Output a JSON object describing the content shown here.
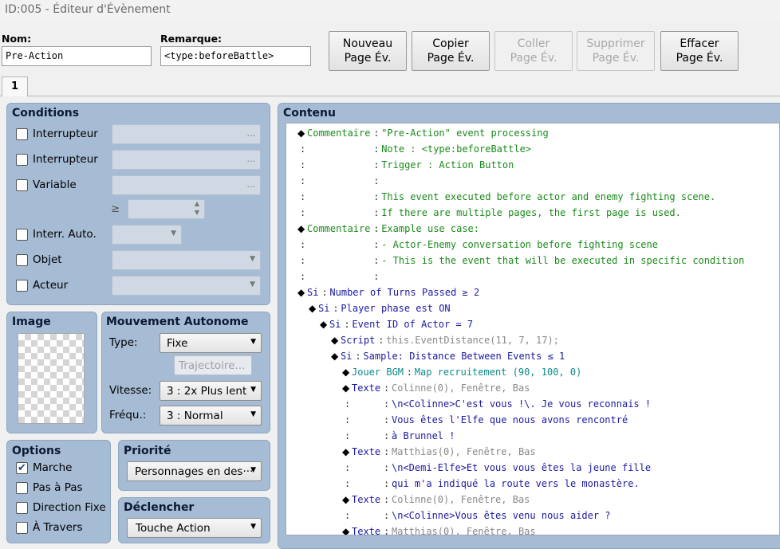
{
  "window": {
    "title": "ID:005 - Éditeur d'Évènement"
  },
  "header": {
    "name_label": "Nom:",
    "name_value": "Pre-Action",
    "note_label": "Remarque:",
    "note_value": "<type:beforeBattle>"
  },
  "buttons": [
    {
      "line1": "Nouveau",
      "line2": "Page Év.",
      "enabled": true
    },
    {
      "line1": "Copier",
      "line2": "Page Év.",
      "enabled": true
    },
    {
      "line1": "Coller",
      "line2": "Page Év.",
      "enabled": false
    },
    {
      "line1": "Supprimer",
      "line2": "Page Év.",
      "enabled": false
    },
    {
      "line1": "Effacer",
      "line2": "Page Év.",
      "enabled": true
    }
  ],
  "tabs": [
    "1"
  ],
  "conditions": {
    "title": "Conditions",
    "switch1": "Interrupteur",
    "switch2": "Interrupteur",
    "variable": "Variable",
    "gte": "≥",
    "self_switch": "Interr. Auto.",
    "item": "Objet",
    "actor": "Acteur",
    "dots": "..."
  },
  "image": {
    "title": "Image"
  },
  "movement": {
    "title": "Mouvement Autonome",
    "type_label": "Type:",
    "type_value": "Fixe",
    "route_button": "Trajectoire...",
    "speed_label": "Vitesse:",
    "speed_value": "3 : 2x Plus lent",
    "freq_label": "Fréqu.:",
    "freq_value": "3 : Normal"
  },
  "options": {
    "title": "Options",
    "walking": "Marche",
    "stepping": "Pas à Pas",
    "direction_fix": "Direction Fixe",
    "through": "À Travers"
  },
  "priority": {
    "title": "Priorité",
    "value": "Personnages en des···"
  },
  "trigger": {
    "title": "Déclencher",
    "value": "Touche Action"
  },
  "contents": {
    "title": "Contenu",
    "lines": [
      {
        "indent": 0,
        "diamond": true,
        "cmd": "Commentaire",
        "color": "g",
        "text": "\"Pre-Action\" event processing",
        "tcolor": "g"
      },
      {
        "indent": 0,
        "diamond": false,
        "cmd": "",
        "color": "k",
        "text": "Note : <type:beforeBattle>",
        "tcolor": "g"
      },
      {
        "indent": 0,
        "diamond": false,
        "cmd": "",
        "color": "k",
        "text": "Trigger : Action Button",
        "tcolor": "g"
      },
      {
        "indent": 0,
        "diamond": false,
        "cmd": "",
        "color": "k",
        "text": "",
        "tcolor": "g"
      },
      {
        "indent": 0,
        "diamond": false,
        "cmd": "",
        "color": "k",
        "text": "This event executed before actor and enemy fighting scene.",
        "tcolor": "g"
      },
      {
        "indent": 0,
        "diamond": false,
        "cmd": "",
        "color": "k",
        "text": "If there are multiple pages, the first page is used.",
        "tcolor": "g"
      },
      {
        "indent": 0,
        "diamond": true,
        "cmd": "Commentaire",
        "color": "g",
        "text": "Example use case:",
        "tcolor": "g"
      },
      {
        "indent": 0,
        "diamond": false,
        "cmd": "",
        "color": "k",
        "text": "- Actor-Enemy conversation before fighting scene",
        "tcolor": "g"
      },
      {
        "indent": 0,
        "diamond": false,
        "cmd": "",
        "color": "k",
        "text": "- This is the event that will be executed in specific condition",
        "tcolor": "g"
      },
      {
        "indent": 0,
        "diamond": false,
        "cmd": "",
        "color": "k",
        "text": "",
        "tcolor": "g"
      },
      {
        "indent": 0,
        "diamond": true,
        "cmd": "Si",
        "color": "b",
        "text": "Number of Turns Passed ≥ 2",
        "tcolor": "b"
      },
      {
        "indent": 1,
        "diamond": true,
        "cmd": "Si",
        "color": "b",
        "text": "Player phase est ON",
        "tcolor": "b"
      },
      {
        "indent": 2,
        "diamond": true,
        "cmd": "Si",
        "color": "b",
        "text": "Event ID of Actor = 7",
        "tcolor": "b"
      },
      {
        "indent": 3,
        "diamond": true,
        "cmd": "Script",
        "color": "b",
        "text": "this.EventDistance(11, 7, 17);",
        "tcolor": "gr"
      },
      {
        "indent": 3,
        "diamond": true,
        "cmd": "Si",
        "color": "b",
        "text": "Sample: Distance Between Events ≤ 1",
        "tcolor": "b"
      },
      {
        "indent": 4,
        "diamond": true,
        "cmd": "Jouer BGM",
        "color": "t",
        "text": "Map recruitement (90, 100, 0)",
        "tcolor": "t"
      },
      {
        "indent": 4,
        "diamond": true,
        "cmd": "Texte",
        "color": "b",
        "text": "Colinne(0), Fenêtre, Bas",
        "tcolor": "gr"
      },
      {
        "indent": 4,
        "diamond": false,
        "cmd": "",
        "color": "k",
        "text": "\\n<Colinne>C'est vous !\\. Je vous reconnais !",
        "tcolor": "b"
      },
      {
        "indent": 4,
        "diamond": false,
        "cmd": "",
        "color": "k",
        "text": "Vous êtes l'Elfe que nous avons rencontré",
        "tcolor": "b"
      },
      {
        "indent": 4,
        "diamond": false,
        "cmd": "",
        "color": "k",
        "text": "à Brunnel !",
        "tcolor": "b"
      },
      {
        "indent": 4,
        "diamond": true,
        "cmd": "Texte",
        "color": "b",
        "text": "Matthias(0), Fenêtre, Bas",
        "tcolor": "gr"
      },
      {
        "indent": 4,
        "diamond": false,
        "cmd": "",
        "color": "k",
        "text": "\\n<Demi-Elfe>Et vous vous êtes la jeune fille",
        "tcolor": "b"
      },
      {
        "indent": 4,
        "diamond": false,
        "cmd": "",
        "color": "k",
        "text": "qui m'a indiqué la route vers le monastère.",
        "tcolor": "b"
      },
      {
        "indent": 4,
        "diamond": true,
        "cmd": "Texte",
        "color": "b",
        "text": "Colinne(0), Fenêtre, Bas",
        "tcolor": "gr"
      },
      {
        "indent": 4,
        "diamond": false,
        "cmd": "",
        "color": "k",
        "text": "\\n<Colinne>Vous êtes venu nous aider ?",
        "tcolor": "b"
      },
      {
        "indent": 4,
        "diamond": true,
        "cmd": "Texte",
        "color": "b",
        "text": "Matthias(0), Fenêtre, Bas",
        "tcolor": "gr"
      }
    ]
  }
}
